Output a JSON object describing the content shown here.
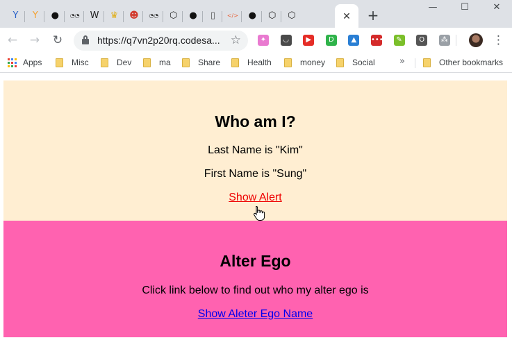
{
  "browser": {
    "tabs": [
      {
        "icon": "y-logo-icon",
        "glyph": "Y",
        "color": "#2b63c9"
      },
      {
        "icon": "orange-y-icon",
        "glyph": "Y",
        "color": "#f4a234"
      },
      {
        "icon": "github-icon",
        "glyph": "●",
        "color": "#111111"
      },
      {
        "icon": "glasses-icon",
        "glyph": "◔◔",
        "color": "#333333"
      },
      {
        "icon": "wikipedia-icon",
        "glyph": "W",
        "color": "#222222"
      },
      {
        "icon": "crown-icon",
        "glyph": "♛",
        "color": "#e0b020"
      },
      {
        "icon": "santa-icon",
        "glyph": "☻",
        "color": "#d23b2e"
      },
      {
        "icon": "glasses-icon",
        "glyph": "◔◔",
        "color": "#333333"
      },
      {
        "icon": "codesandbox-icon",
        "glyph": "⬡",
        "color": "#222222"
      },
      {
        "icon": "github-icon",
        "glyph": "●",
        "color": "#111111"
      },
      {
        "icon": "document-icon",
        "glyph": "▯",
        "color": "#555555"
      },
      {
        "icon": "code-icon",
        "glyph": "</>",
        "color": "#e8643a"
      },
      {
        "icon": "github-icon",
        "glyph": "●",
        "color": "#111111"
      },
      {
        "icon": "codesandbox-icon",
        "glyph": "⬡",
        "color": "#222222"
      },
      {
        "icon": "codesandbox-icon",
        "glyph": "⬡",
        "color": "#222222"
      }
    ],
    "active_tab_close": "✕",
    "new_tab": "+",
    "window_controls": {
      "minimize": "—",
      "maximize": "☐",
      "close": "✕"
    },
    "nav": {
      "back": "←",
      "forward": "→",
      "reload": "↻"
    },
    "url": "https://q7vn2p20rq.codesa...",
    "star": "☆",
    "extensions": [
      {
        "icon": "unicorn-extension-icon",
        "glyph": "✦",
        "color": "#e97ad0"
      },
      {
        "icon": "pocket-extension-icon",
        "glyph": "◡",
        "color": "#4a4a4a"
      },
      {
        "icon": "youtube-extension-icon",
        "glyph": "▶",
        "color": "#e52d27"
      },
      {
        "icon": "dot-extension-icon",
        "glyph": "D",
        "color": "#2fb34a"
      },
      {
        "icon": "triangle-extension-icon",
        "glyph": "▲",
        "color": "#2a7fd4"
      },
      {
        "icon": "red-badge-extension-icon",
        "glyph": "•••",
        "color": "#d42b2b"
      },
      {
        "icon": "broom-extension-icon",
        "glyph": "✎",
        "color": "#7bbf2a"
      },
      {
        "icon": "o-extension-icon",
        "glyph": "O",
        "color": "#555555"
      },
      {
        "icon": "network-extension-icon",
        "glyph": "⁂",
        "color": "#9aa0a6"
      }
    ],
    "menu": "⋮",
    "bookmarks": {
      "apps": "Apps",
      "items": [
        "Misc",
        "Dev",
        "ma",
        "Share",
        "Health",
        "money",
        "Social"
      ],
      "overflow": "»",
      "other": "Other bookmarks"
    }
  },
  "page": {
    "section_a": {
      "title": "Who am I?",
      "last_name": "Last Name is \"Kim\"",
      "first_name": "First Name is \"Sung\"",
      "link": "Show Alert",
      "background": "#ffeed2"
    },
    "section_b": {
      "title": "Alter Ego",
      "text": "Click link below to find out who my alter ego is",
      "link": "Show Aleter Ego Name",
      "background": "#ff62b0"
    }
  }
}
